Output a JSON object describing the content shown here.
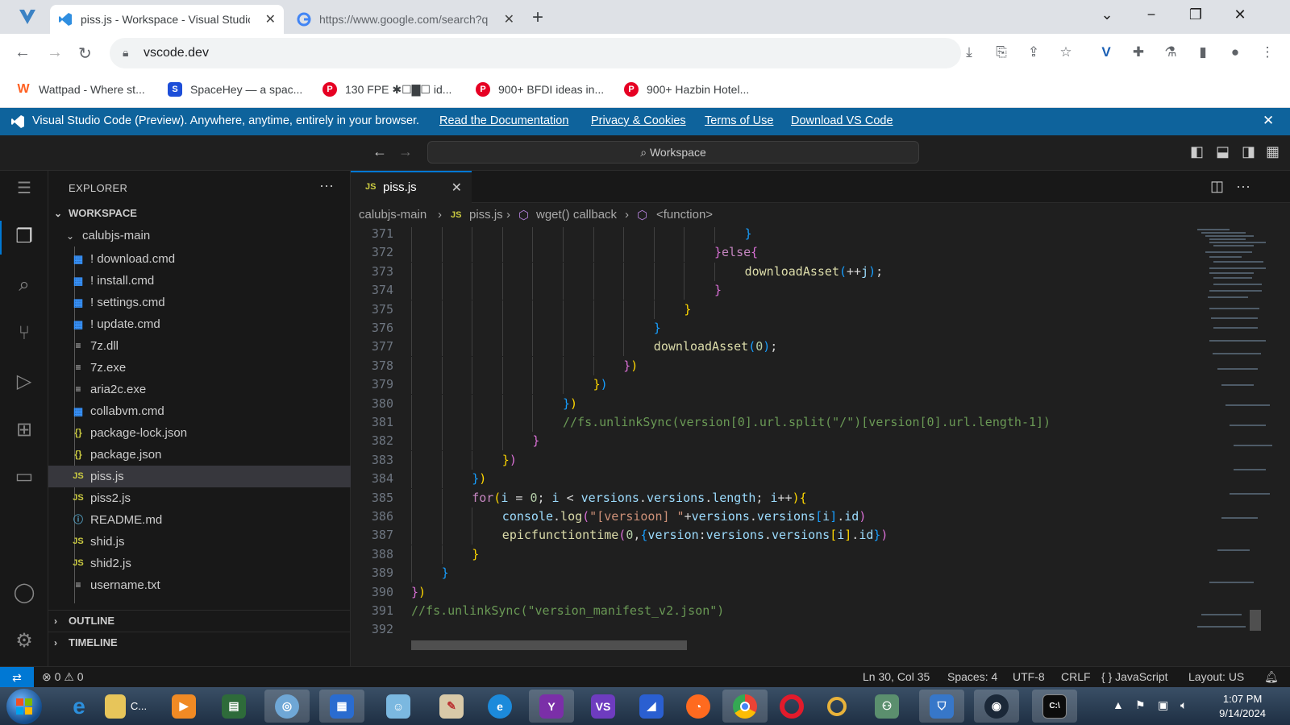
{
  "browser": {
    "tabs": [
      {
        "title": "piss.js - Workspace - Visual Studio Code",
        "active": true
      },
      {
        "title": "https://www.google.com/search?q=",
        "active": false
      }
    ],
    "url": "vscode.dev",
    "bookmarks": [
      {
        "label": "Wattpad - Where st...",
        "color": "#ff6122"
      },
      {
        "label": "SpaceHey — a spac...",
        "color": "#1d4ed8"
      },
      {
        "label": "130 FPE ✱☐▇☐ id...",
        "color": "#e60023"
      },
      {
        "label": "900+ BFDI ideas in...",
        "color": "#e60023"
      },
      {
        "label": "900+ Hazbin Hotel...",
        "color": "#e60023"
      }
    ]
  },
  "banner": {
    "message": "Visual Studio Code (Preview). Anywhere, anytime, entirely in your browser.",
    "links": [
      "Read the Documentation",
      "Privacy & Cookies",
      "Terms of Use",
      "Download VS Code"
    ]
  },
  "titlebar": {
    "command_center": "Workspace"
  },
  "explorer": {
    "header": "EXPLORER",
    "workspace_label": "WORKSPACE",
    "folder": "calubjs-main",
    "files": [
      {
        "name": "! download.cmd",
        "type": "win"
      },
      {
        "name": "! install.cmd",
        "type": "win"
      },
      {
        "name": "! settings.cmd",
        "type": "win"
      },
      {
        "name": "! update.cmd",
        "type": "win"
      },
      {
        "name": "7z.dll",
        "type": "txt"
      },
      {
        "name": "7z.exe",
        "type": "txt"
      },
      {
        "name": "aria2c.exe",
        "type": "txt"
      },
      {
        "name": "collabvm.cmd",
        "type": "win"
      },
      {
        "name": "package-lock.json",
        "type": "json"
      },
      {
        "name": "package.json",
        "type": "json"
      },
      {
        "name": "piss.js",
        "type": "js",
        "selected": true
      },
      {
        "name": "piss2.js",
        "type": "js"
      },
      {
        "name": "README.md",
        "type": "info"
      },
      {
        "name": "shid.js",
        "type": "js"
      },
      {
        "name": "shid2.js",
        "type": "js"
      },
      {
        "name": "username.txt",
        "type": "txt"
      }
    ],
    "outline_label": "OUTLINE",
    "timeline_label": "TIMELINE"
  },
  "editor": {
    "tab": {
      "badge": "JS",
      "name": "piss.js"
    },
    "breadcrumbs": [
      "calubjs-main",
      "piss.js",
      "wget() callback",
      "<function>"
    ],
    "lines": [
      {
        "n": "371",
        "indent": 11,
        "tokens": [
          [
            "b3",
            "}"
          ]
        ]
      },
      {
        "n": "372",
        "indent": 10,
        "tokens": [
          [
            "b2",
            "}"
          ],
          [
            "kw",
            "else"
          ],
          [
            "b2",
            "{"
          ]
        ]
      },
      {
        "n": "373",
        "indent": 11,
        "tokens": [
          [
            "fn",
            "downloadAsset"
          ],
          [
            "b3",
            "("
          ],
          [
            "pl",
            "++"
          ],
          [
            "vr",
            "j"
          ],
          [
            "b3",
            ")"
          ],
          [
            "pl",
            ";"
          ]
        ]
      },
      {
        "n": "374",
        "indent": 10,
        "tokens": [
          [
            "b2",
            "}"
          ]
        ]
      },
      {
        "n": "375",
        "indent": 9,
        "tokens": [
          [
            "b1",
            "}"
          ]
        ]
      },
      {
        "n": "376",
        "indent": 8,
        "tokens": [
          [
            "b3",
            "}"
          ]
        ]
      },
      {
        "n": "377",
        "indent": 8,
        "tokens": [
          [
            "fn",
            "downloadAsset"
          ],
          [
            "b3",
            "("
          ],
          [
            "num",
            "0"
          ],
          [
            "b3",
            ")"
          ],
          [
            "pl",
            ";"
          ]
        ]
      },
      {
        "n": "378",
        "indent": 7,
        "tokens": [
          [
            "b2",
            "}"
          ],
          [
            "b1",
            ")"
          ]
        ]
      },
      {
        "n": "379",
        "indent": 6,
        "tokens": [
          [
            "b1",
            "}"
          ],
          [
            "b3",
            ")"
          ]
        ]
      },
      {
        "n": "380",
        "indent": 5,
        "tokens": [
          [
            "b3",
            "}"
          ],
          [
            "b1",
            ")"
          ]
        ]
      },
      {
        "n": "381",
        "indent": 5,
        "tokens": [
          [
            "cm",
            "//fs.unlinkSync(version[0].url.split(\"/\")[version[0].url.length-1])"
          ]
        ]
      },
      {
        "n": "382",
        "indent": 4,
        "tokens": [
          [
            "b2",
            "}"
          ]
        ]
      },
      {
        "n": "383",
        "indent": 3,
        "tokens": [
          [
            "b1",
            "}"
          ],
          [
            "b2",
            ")"
          ]
        ]
      },
      {
        "n": "384",
        "indent": 2,
        "tokens": [
          [
            "b3",
            "}"
          ],
          [
            "b1",
            ")"
          ]
        ]
      },
      {
        "n": "385",
        "indent": 2,
        "tokens": [
          [
            "kw",
            "for"
          ],
          [
            "b1",
            "("
          ],
          [
            "vr",
            "i"
          ],
          [
            "pl",
            " = "
          ],
          [
            "num",
            "0"
          ],
          [
            "pl",
            "; "
          ],
          [
            "vr",
            "i"
          ],
          [
            "pl",
            " < "
          ],
          [
            "vr",
            "versions"
          ],
          [
            "pl",
            "."
          ],
          [
            "vr",
            "versions"
          ],
          [
            "pl",
            "."
          ],
          [
            "vr",
            "length"
          ],
          [
            "pl",
            "; "
          ],
          [
            "vr",
            "i"
          ],
          [
            "pl",
            "++"
          ],
          [
            "b1",
            ")"
          ],
          [
            "b1",
            "{"
          ]
        ]
      },
      {
        "n": "386",
        "indent": 3,
        "tokens": [
          [
            "vr",
            "console"
          ],
          [
            "pl",
            "."
          ],
          [
            "fn",
            "log"
          ],
          [
            "b2",
            "("
          ],
          [
            "str",
            "\"[versioon] \""
          ],
          [
            "pl",
            "+"
          ],
          [
            "vr",
            "versions"
          ],
          [
            "pl",
            "."
          ],
          [
            "vr",
            "versions"
          ],
          [
            "b3",
            "["
          ],
          [
            "vr",
            "i"
          ],
          [
            "b3",
            "]"
          ],
          [
            "pl",
            "."
          ],
          [
            "vr",
            "id"
          ],
          [
            "b2",
            ")"
          ]
        ]
      },
      {
        "n": "387",
        "indent": 3,
        "tokens": [
          [
            "fn",
            "epicfunctiontime"
          ],
          [
            "b2",
            "("
          ],
          [
            "num",
            "0"
          ],
          [
            "pl",
            ","
          ],
          [
            "b3",
            "{"
          ],
          [
            "vr",
            "version"
          ],
          [
            "pl",
            ":"
          ],
          [
            "vr",
            "versions"
          ],
          [
            "pl",
            "."
          ],
          [
            "vr",
            "versions"
          ],
          [
            "b1",
            "["
          ],
          [
            "vr",
            "i"
          ],
          [
            "b1",
            "]"
          ],
          [
            "pl",
            "."
          ],
          [
            "vr",
            "id"
          ],
          [
            "b3",
            "}"
          ],
          [
            "b2",
            ")"
          ]
        ]
      },
      {
        "n": "388",
        "indent": 2,
        "tokens": [
          [
            "b1",
            "}"
          ]
        ]
      },
      {
        "n": "389",
        "indent": 1,
        "tokens": [
          [
            "b3",
            "}"
          ]
        ]
      },
      {
        "n": "390",
        "indent": 0,
        "tokens": [
          [
            "b2",
            "}"
          ],
          [
            "b1",
            ")"
          ]
        ]
      },
      {
        "n": "391",
        "indent": 0,
        "tokens": [
          [
            "cm",
            "//fs.unlinkSync(\"version_manifest_v2.json\")"
          ]
        ]
      },
      {
        "n": "392",
        "indent": 0,
        "tokens": []
      }
    ]
  },
  "statusbar": {
    "errors": "0",
    "warnings": "0",
    "position": "Ln 30, Col 35",
    "spaces": "Spaces: 4",
    "encoding": "UTF-8",
    "eol": "CRLF",
    "language": "JavaScript",
    "layout": "Layout: US"
  },
  "taskbar": {
    "time": "1:07 PM",
    "date": "9/14/2024",
    "app_label": "C..."
  },
  "colors": {
    "accent": "#0078d4",
    "banner": "#0e639c"
  }
}
